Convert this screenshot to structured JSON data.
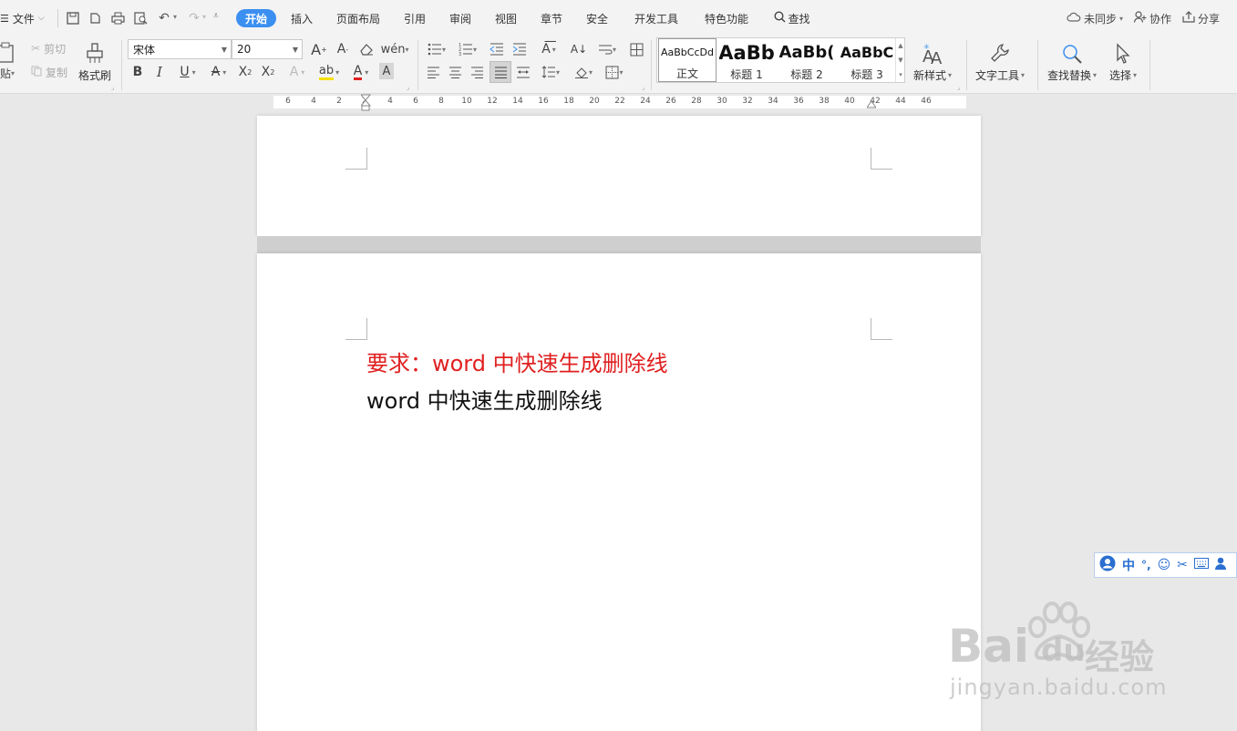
{
  "menubar": {
    "file_label": "文件",
    "tabs": [
      "开始",
      "插入",
      "页面布局",
      "引用",
      "审阅",
      "视图",
      "章节",
      "安全",
      "开发工具",
      "特色功能"
    ],
    "search_label": "查找",
    "sync_label": "未同步",
    "collab_label": "协作",
    "share_label": "分享"
  },
  "ribbon": {
    "paste_label": "粘贴",
    "cut_label": "剪切",
    "copy_label": "复制",
    "format_painter_label": "格式刷",
    "font_name": "宋体",
    "font_size": "20",
    "new_style_label": "新样式",
    "text_tools_label": "文字工具",
    "find_replace_label": "查找替换",
    "select_label": "选择",
    "styles": [
      {
        "preview": "AaBbCcDd",
        "name": "正文"
      },
      {
        "preview": "AaBb",
        "name": "标题 1"
      },
      {
        "preview": "AaBb(",
        "name": "标题 2"
      },
      {
        "preview": "AaBbC",
        "name": "标题 3"
      }
    ]
  },
  "ruler_ticks": [
    "6",
    "4",
    "2",
    "2",
    "4",
    "6",
    "8",
    "10",
    "12",
    "14",
    "16",
    "18",
    "20",
    "22",
    "24",
    "26",
    "28",
    "30",
    "32",
    "34",
    "36",
    "38",
    "40",
    "42",
    "44",
    "46"
  ],
  "document": {
    "line1": "要求：word 中快速生成删除线",
    "line2": "word 中快速生成删除线"
  },
  "ime": {
    "lang": "中"
  },
  "watermark": {
    "brand": "Bai",
    "brand2": "du",
    "cn": "经验",
    "url": "jingyan.baidu.com"
  },
  "colors": {
    "accent": "#3b8ff0",
    "requirement_red": "#e02020"
  }
}
